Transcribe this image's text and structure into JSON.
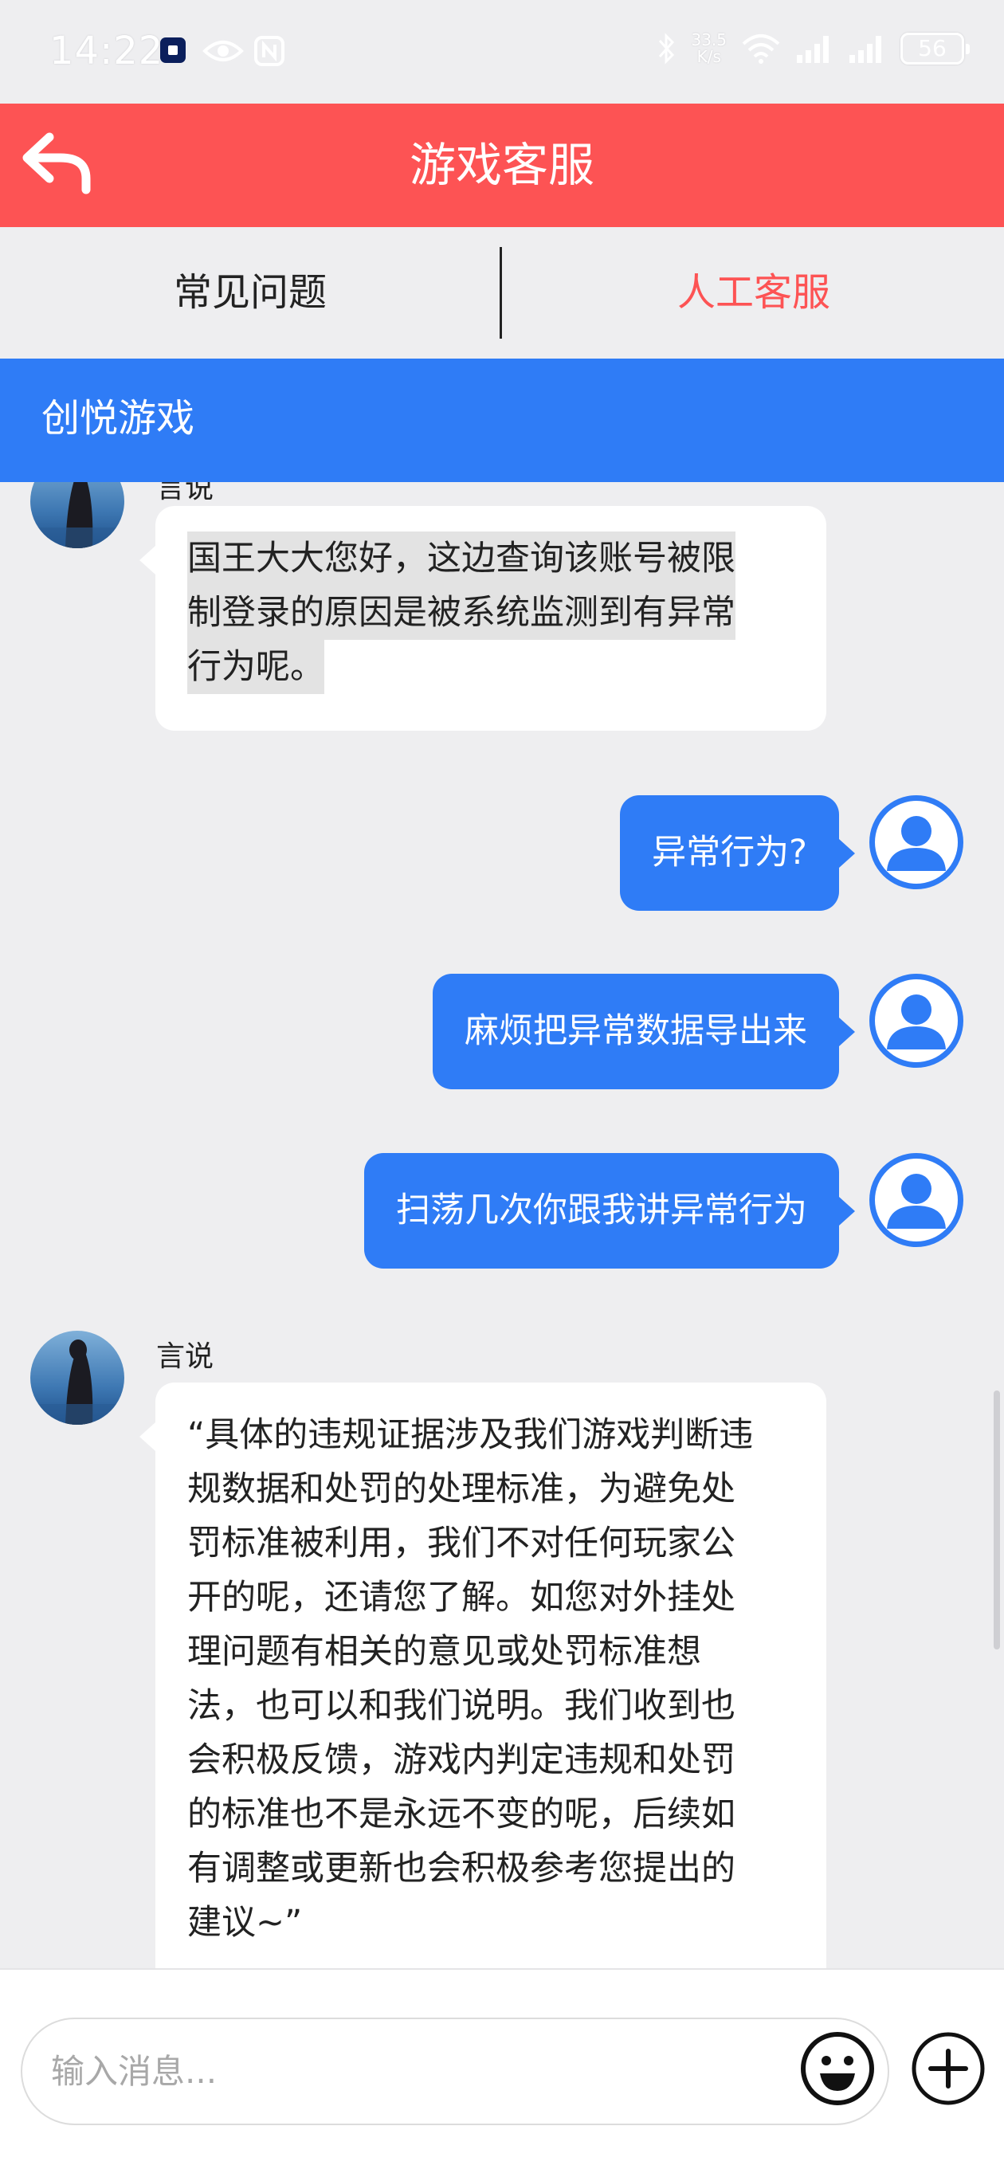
{
  "status_bar": {
    "time": "14:22",
    "net_speed_value": "33.5",
    "net_speed_unit": "K/s",
    "battery": "56",
    "icons": [
      "notification-app-icon",
      "eye-icon",
      "nfc-icon",
      "bluetooth-icon",
      "wifi-icon",
      "signal-icon",
      "signal-icon",
      "battery-icon"
    ]
  },
  "header": {
    "title": "游戏客服",
    "back_icon": "back-arrow-icon"
  },
  "tabs": {
    "faq": "常见问题",
    "agent": "人工客服"
  },
  "banner": {
    "title": "创悦游戏"
  },
  "messages": [
    {
      "from": "agent",
      "name": "言说",
      "lines": [
        "国王大大您好，这边查询该账号被限",
        "制登录的原因是被系统监测到有异常",
        "行为呢。"
      ]
    },
    {
      "from": "user",
      "text": "异常行为?"
    },
    {
      "from": "user",
      "text": "麻烦把异常数据导出来"
    },
    {
      "from": "user",
      "text": "扫荡几次你跟我讲异常行为"
    },
    {
      "from": "agent",
      "name": "言说",
      "lines": [
        "“具体的违规证据涉及我们游戏判断违",
        "规数据和处罚的处理标准，为避免处",
        "罚标准被利用，我们不对任何玩家公",
        "开的呢，还请您了解。如您对外挂处",
        "理问题有相关的意见或处罚标准想",
        "法，也可以和我们说明。我们收到也",
        "会积极反馈，游戏内判定违规和处罚",
        "的标准也不是永远不变的呢，后续如",
        "有调整或更新也会积极参考您提出的",
        "建议~”"
      ]
    }
  ],
  "input": {
    "placeholder": "输入消息...",
    "emoji_icon": "emoji-icon",
    "add_icon": "plus-icon"
  },
  "colors": {
    "header_red": "#fd5354",
    "accent_blue": "#2f7cf6",
    "background": "#eeeef0"
  }
}
